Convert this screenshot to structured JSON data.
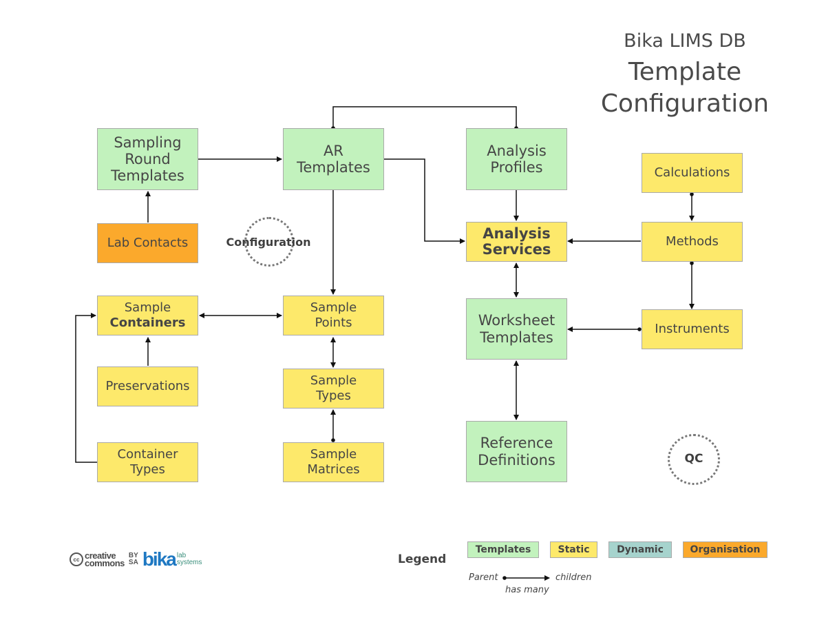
{
  "title": {
    "line1": "Bika LIMS DB",
    "line2": "Template",
    "line3": "Configuration"
  },
  "colors": {
    "templates": "#c2f2bd",
    "static": "#fde96b",
    "dynamic": "#a6d3cd",
    "organisation": "#fba92c",
    "border": "#a9a9a9",
    "line": "#111111"
  },
  "nodes": {
    "sampling_round_templates": {
      "lines": [
        "Sampling",
        "Round",
        "Templates"
      ],
      "category": "Templates"
    },
    "ar_templates": {
      "lines": [
        "AR",
        "Templates"
      ],
      "category": "Templates"
    },
    "analysis_profiles": {
      "lines": [
        "Analysis",
        "Profiles"
      ],
      "category": "Templates"
    },
    "calculations": {
      "lines": [
        "Calculations"
      ],
      "category": "Static"
    },
    "lab_contacts": {
      "lines": [
        "Lab Contacts"
      ],
      "category": "Organisation"
    },
    "analysis_services": {
      "lines": [
        "Analysis",
        "Services"
      ],
      "category": "Static"
    },
    "methods": {
      "lines": [
        "Methods"
      ],
      "category": "Static"
    },
    "sample_containers": {
      "lines": [
        "Sample",
        "Containers"
      ],
      "category": "Static"
    },
    "sample_points": {
      "lines": [
        "Sample",
        "Points"
      ],
      "category": "Static"
    },
    "worksheet_templates": {
      "lines": [
        "Worksheet",
        "Templates"
      ],
      "category": "Templates"
    },
    "instruments": {
      "lines": [
        "Instruments"
      ],
      "category": "Static"
    },
    "preservations": {
      "lines": [
        "Preservations"
      ],
      "category": "Static"
    },
    "sample_types": {
      "lines": [
        "Sample",
        "Types"
      ],
      "category": "Static"
    },
    "container_types": {
      "lines": [
        "Container",
        "Types"
      ],
      "category": "Static"
    },
    "sample_matrices": {
      "lines": [
        "Sample",
        "Matrices"
      ],
      "category": "Static"
    },
    "reference_definitions": {
      "lines": [
        "Reference",
        "Definitions"
      ],
      "category": "Templates"
    }
  },
  "edges": [
    {
      "from": "ar_templates",
      "to": "analysis_profiles",
      "type": "parent-dot-both"
    },
    {
      "from": "sampling_round_templates",
      "to": "ar_templates",
      "type": "arrow"
    },
    {
      "from": "lab_contacts",
      "to": "sampling_round_templates",
      "type": "arrow"
    },
    {
      "from": "ar_templates",
      "to": "analysis_services",
      "type": "arrow"
    },
    {
      "from": "ar_templates",
      "to": "sample_points",
      "type": "arrow"
    },
    {
      "from": "analysis_profiles",
      "to": "analysis_services",
      "type": "arrow"
    },
    {
      "from": "calculations",
      "to": "methods",
      "type": "has-many"
    },
    {
      "from": "methods",
      "to": "analysis_services",
      "type": "arrow"
    },
    {
      "from": "methods",
      "to": "instruments",
      "type": "has-many"
    },
    {
      "from": "analysis_services",
      "to": "worksheet_templates",
      "type": "bidirectional"
    },
    {
      "from": "instruments",
      "to": "worksheet_templates",
      "type": "has-many"
    },
    {
      "from": "worksheet_templates",
      "to": "reference_definitions",
      "type": "bidirectional"
    },
    {
      "from": "sample_containers",
      "to": "sample_points",
      "type": "bidirectional"
    },
    {
      "from": "preservations",
      "to": "sample_containers",
      "type": "arrow"
    },
    {
      "from": "container_types",
      "to": "sample_containers",
      "type": "arrow"
    },
    {
      "from": "sample_points",
      "to": "sample_types",
      "type": "bidirectional"
    },
    {
      "from": "sample_matrices",
      "to": "sample_types",
      "type": "has-many"
    }
  ],
  "groups": {
    "configuration": "Configuration",
    "qc": "QC"
  },
  "footer": {
    "cc_line1": "creative",
    "cc_line2": "commons",
    "cc_symbol": "cc",
    "by": "BY",
    "sa": "SA",
    "bika": "bika",
    "bika_sub1": "lab",
    "bika_sub2": "systems"
  },
  "legend": {
    "title": "Legend",
    "items": [
      {
        "label": "Templates",
        "color": "#c2f2bd"
      },
      {
        "label": "Static",
        "color": "#fde96b"
      },
      {
        "label": "Dynamic",
        "color": "#a6d3cd"
      },
      {
        "label": "Organisation",
        "color": "#fba92c"
      }
    ],
    "parent": "Parent",
    "children": "children",
    "has_many": "has many"
  }
}
